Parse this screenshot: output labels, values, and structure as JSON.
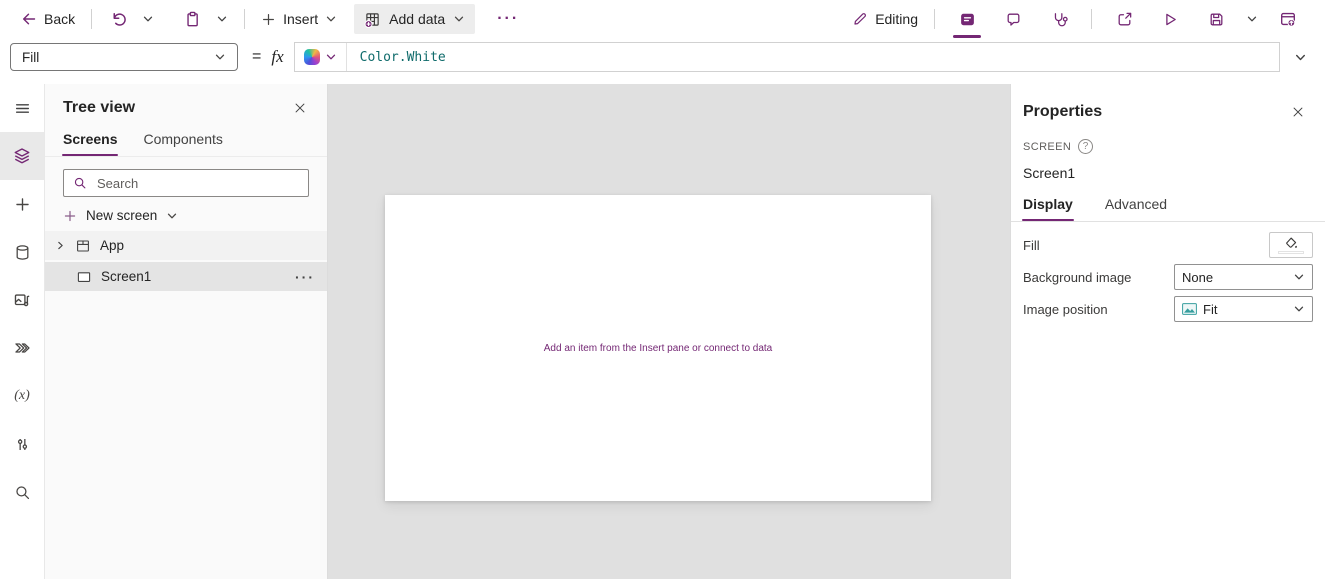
{
  "colors": {
    "accent": "#742774",
    "formula_text": "#0f6b6b",
    "workspace_background": "#e0e0e0",
    "selected_row": "#e4e4e4"
  },
  "topbar": {
    "back_label": "Back",
    "insert_label": "Insert",
    "add_data_label": "Add data",
    "more_glyph": "···",
    "editing_label": "Editing"
  },
  "formula_bar": {
    "property_selected": "Fill",
    "equals": "=",
    "fx": "fx",
    "formula": "Color.White"
  },
  "left_rail": {
    "variables_glyph": "(x)"
  },
  "tree_view": {
    "title": "Tree view",
    "tab_screens": "Screens",
    "tab_components": "Components",
    "search_placeholder": "Search",
    "new_screen_label": "New screen",
    "app_label": "App",
    "screen1_label": "Screen1",
    "row_more_glyph": "···"
  },
  "canvas": {
    "hint_prefix": "Add an item from the ",
    "insert_pane_link": "Insert pane",
    "hint_or": " or ",
    "connect_link": "connect to data"
  },
  "properties": {
    "title": "Properties",
    "type_label": "SCREEN",
    "name": "Screen1",
    "tab_display": "Display",
    "tab_advanced": "Advanced",
    "fill_label": "Fill",
    "background_image_label": "Background image",
    "background_image_value": "None",
    "image_position_label": "Image position",
    "image_position_value": "Fit"
  }
}
